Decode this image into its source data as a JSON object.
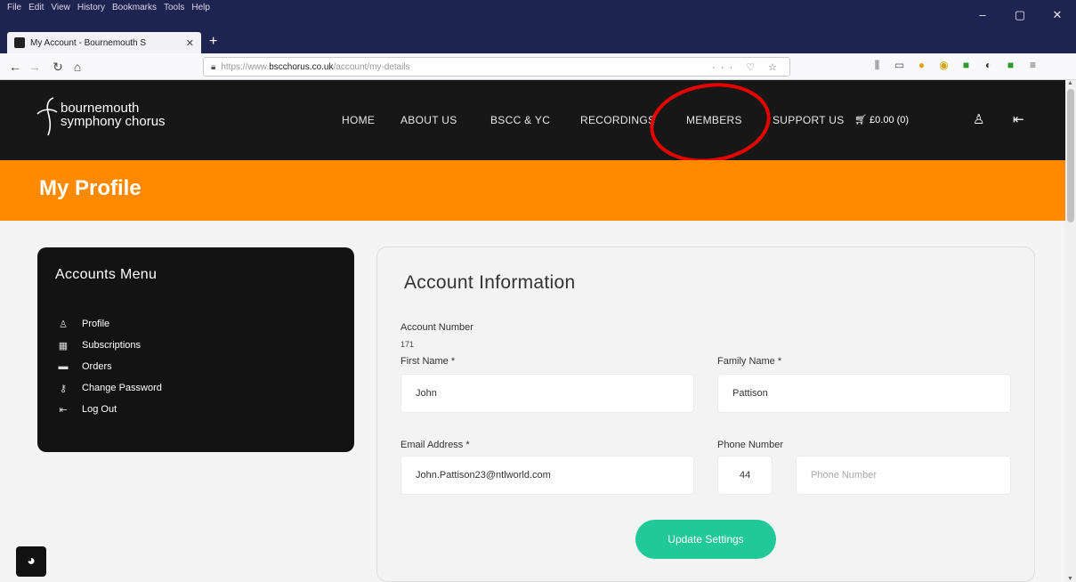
{
  "browser": {
    "menu": [
      "File",
      "Edit",
      "View",
      "History",
      "Bookmarks",
      "Tools",
      "Help"
    ],
    "tab_title": "My Account - Bournemouth S",
    "url_prefix": "https://www.",
    "url_domain": "bscchorus.co.uk",
    "url_path": "/account/my-details",
    "window_controls": [
      "–",
      "▢",
      "✕"
    ]
  },
  "site": {
    "logo_line1": "bournemouth",
    "logo_line2": "symphony chorus",
    "nav": [
      "HOME",
      "ABOUT US",
      "BSCC & YC",
      "RECORDINGS",
      "MEMBERS",
      "SUPPORT US"
    ],
    "cart": "£0.00 (0)"
  },
  "banner": {
    "title": "My Profile"
  },
  "accounts_menu": {
    "title": "Accounts Menu",
    "items": [
      "Profile",
      "Subscriptions",
      "Orders",
      "Change Password",
      "Log Out"
    ]
  },
  "account": {
    "title": "Account Information",
    "account_number_label": "Account Number",
    "account_number_value": "171",
    "first_name_label": "First Name *",
    "first_name_value": "John",
    "family_name_label": "Family Name *",
    "family_name_value": "Pattison",
    "email_label": "Email Address *",
    "email_value": "John.Pattison23@ntlworld.com",
    "phone_label": "Phone Number",
    "phone_code": "44",
    "phone_placeholder": "Phone Number",
    "update_button": "Update Settings"
  },
  "colors": {
    "accent_orange": "#ff8a00",
    "button_green": "#20c997",
    "annotation_red": "#e80000"
  }
}
